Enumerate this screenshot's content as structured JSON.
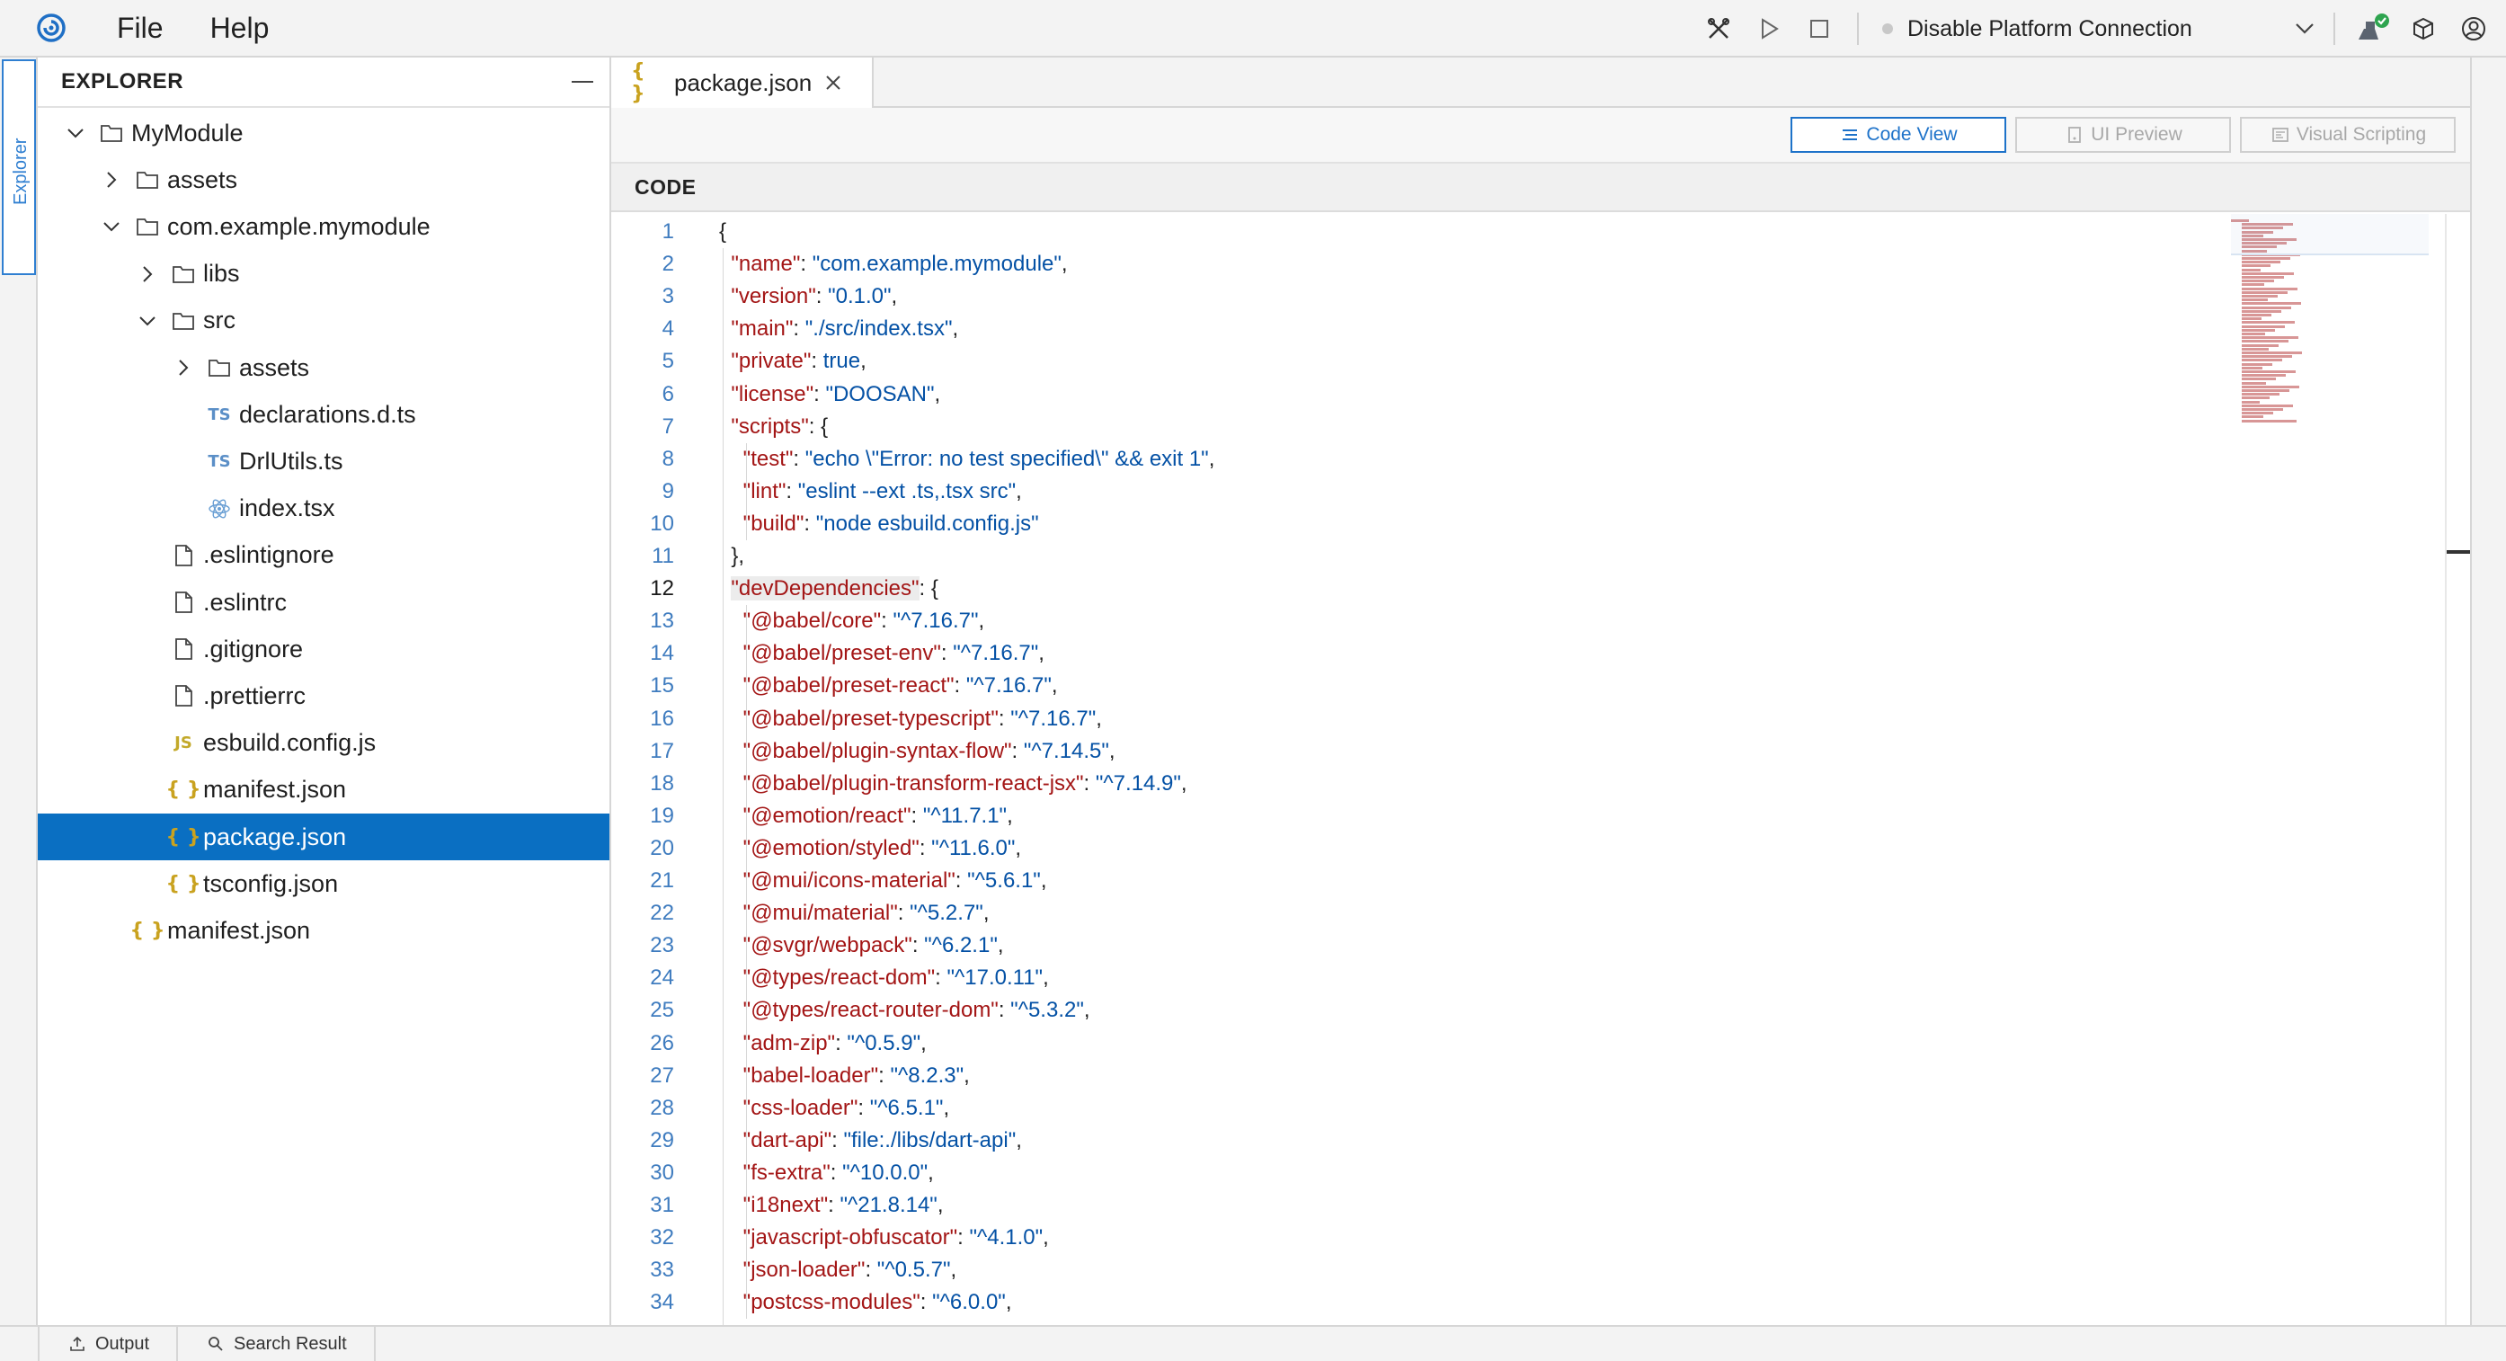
{
  "menu": {
    "file": "File",
    "help": "Help"
  },
  "toolbar": {
    "platform_label": "Disable Platform Connection"
  },
  "activity": {
    "explorer_tab": "Explorer"
  },
  "explorer": {
    "title": "EXPLORER",
    "tree": [
      {
        "label": "MyModule",
        "type": "folder",
        "expanded": true
      },
      {
        "label": "assets",
        "type": "folder",
        "expanded": false
      },
      {
        "label": "com.example.mymodule",
        "type": "folder",
        "expanded": true
      },
      {
        "label": "libs",
        "type": "folder",
        "expanded": false
      },
      {
        "label": "src",
        "type": "folder",
        "expanded": true
      },
      {
        "label": "assets",
        "type": "folder",
        "expanded": false
      },
      {
        "label": "declarations.d.ts",
        "type": "ts"
      },
      {
        "label": "DrlUtils.ts",
        "type": "ts"
      },
      {
        "label": "index.tsx",
        "type": "react"
      },
      {
        "label": ".eslintignore",
        "type": "file"
      },
      {
        "label": ".eslintrc",
        "type": "file"
      },
      {
        "label": ".gitignore",
        "type": "file"
      },
      {
        "label": ".prettierrc",
        "type": "file"
      },
      {
        "label": "esbuild.config.js",
        "type": "js"
      },
      {
        "label": "manifest.json",
        "type": "json"
      },
      {
        "label": "package.json",
        "type": "json",
        "selected": true
      },
      {
        "label": "tsconfig.json",
        "type": "json"
      },
      {
        "label": "manifest.json",
        "type": "json"
      }
    ],
    "icon_labels": {
      "ts": "TS",
      "js": "JS",
      "json": "{ }"
    }
  },
  "editor": {
    "tab_label": "package.json",
    "views": {
      "code": "Code View",
      "ui": "UI Preview",
      "visual": "Visual Scripting"
    },
    "section_title": "CODE",
    "current_line": 12,
    "lines": [
      "{",
      "  \"name\": \"com.example.mymodule\",",
      "  \"version\": \"0.1.0\",",
      "  \"main\": \"./src/index.tsx\",",
      "  \"private\": true,",
      "  \"license\": \"DOOSAN\",",
      "  \"scripts\": {",
      "    \"test\": \"echo \\\"Error: no test specified\\\" && exit 1\",",
      "    \"lint\": \"eslint --ext .ts,.tsx src\",",
      "    \"build\": \"node esbuild.config.js\"",
      "  },",
      "  \"devDependencies\": {",
      "    \"@babel/core\": \"^7.16.7\",",
      "    \"@babel/preset-env\": \"^7.16.7\",",
      "    \"@babel/preset-react\": \"^7.16.7\",",
      "    \"@babel/preset-typescript\": \"^7.16.7\",",
      "    \"@babel/plugin-syntax-flow\": \"^7.14.5\",",
      "    \"@babel/plugin-transform-react-jsx\": \"^7.14.9\",",
      "    \"@emotion/react\": \"^11.7.1\",",
      "    \"@emotion/styled\": \"^11.6.0\",",
      "    \"@mui/icons-material\": \"^5.6.1\",",
      "    \"@mui/material\": \"^5.2.7\",",
      "    \"@svgr/webpack\": \"^6.2.1\",",
      "    \"@types/react-dom\": \"^17.0.11\",",
      "    \"@types/react-router-dom\": \"^5.3.2\",",
      "    \"adm-zip\": \"^0.5.9\",",
      "    \"babel-loader\": \"^8.2.3\",",
      "    \"css-loader\": \"^6.5.1\",",
      "    \"dart-api\": \"file:./libs/dart-api\",",
      "    \"fs-extra\": \"^10.0.0\",",
      "    \"i18next\": \"^21.8.14\",",
      "    \"javascript-obfuscator\": \"^4.1.0\",",
      "    \"json-loader\": \"^0.5.7\",",
      "    \"postcss-modules\": \"^6.0.0\","
    ]
  },
  "bottom": {
    "output": "Output",
    "search": "Search Result"
  }
}
